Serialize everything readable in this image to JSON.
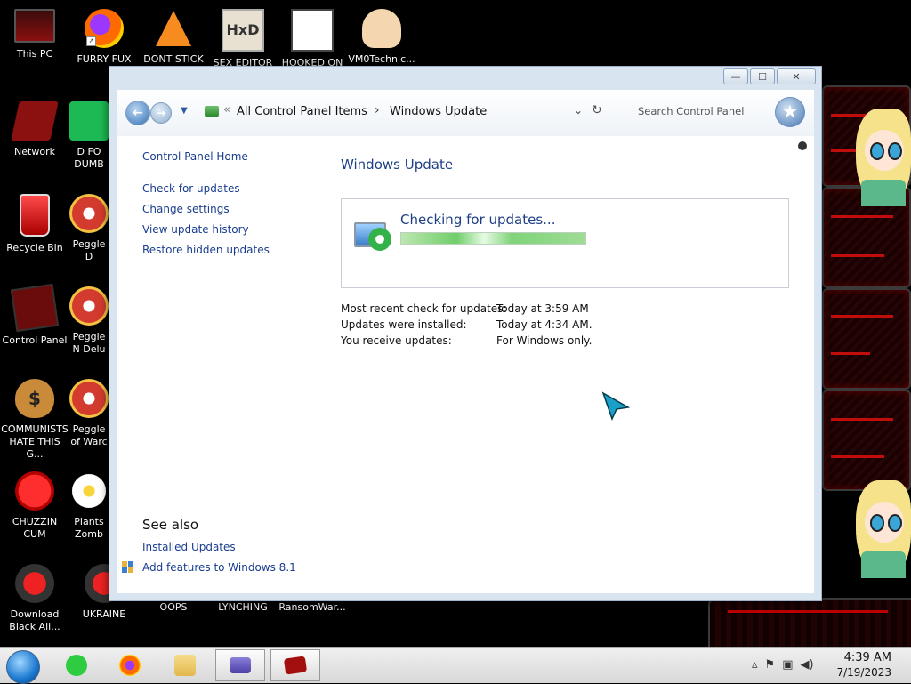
{
  "desktop": {
    "icons": [
      {
        "label": "This PC"
      },
      {
        "label": "FURRY FUX"
      },
      {
        "label": "DONT STICK"
      },
      {
        "label": "SEX EDITOR"
      },
      {
        "label": "HOOKED ON"
      },
      {
        "label": "VM0Technic..."
      },
      {
        "label": "Network"
      },
      {
        "label": "D FO DUMB"
      },
      {
        "label": "Recycle Bin"
      },
      {
        "label": "Peggle D"
      },
      {
        "label": "Control Panel"
      },
      {
        "label": "Peggle N Delu"
      },
      {
        "label": "COMMUNISTS HATE THIS G..."
      },
      {
        "label": "Peggle of Warc"
      },
      {
        "label": "CHUZZIN CUM"
      },
      {
        "label": "Plants Zomb"
      },
      {
        "label": "Download Black Ali..."
      },
      {
        "label": "UKRAINE"
      },
      {
        "label": "OOPS"
      },
      {
        "label": "LYNCHING"
      },
      {
        "label": "RansomWar..."
      }
    ]
  },
  "window": {
    "controls": {
      "minimize": "—",
      "maximize": "☐",
      "close": "✕"
    },
    "breadcrumb": {
      "overflow": "«",
      "items": [
        "All Control Panel Items",
        "Windows Update"
      ]
    },
    "search": {
      "placeholder": "Search Control Panel"
    },
    "sidebar": {
      "links": [
        "Control Panel Home",
        "Check for updates",
        "Change settings",
        "View update history",
        "Restore hidden updates"
      ],
      "see_also_title": "See also",
      "see_also": [
        "Installed Updates",
        "Add features to Windows 8.1"
      ]
    },
    "main": {
      "title": "Windows Update",
      "status": "Checking for updates...",
      "progress_fraction": 1.0,
      "info": [
        {
          "label": "Most recent check for updates:",
          "value": "Today at 3:59 AM"
        },
        {
          "label": "Updates were installed:",
          "value": "Today at 4:34 AM."
        },
        {
          "label": "You receive updates:",
          "value": "For Windows only."
        }
      ]
    }
  },
  "taskbar": {
    "apps": [
      "notes-app",
      "firefox",
      "file-explorer",
      "control-panel",
      "media-app"
    ],
    "clock": {
      "time": "4:39 AM",
      "date": "7/19/2023"
    }
  }
}
